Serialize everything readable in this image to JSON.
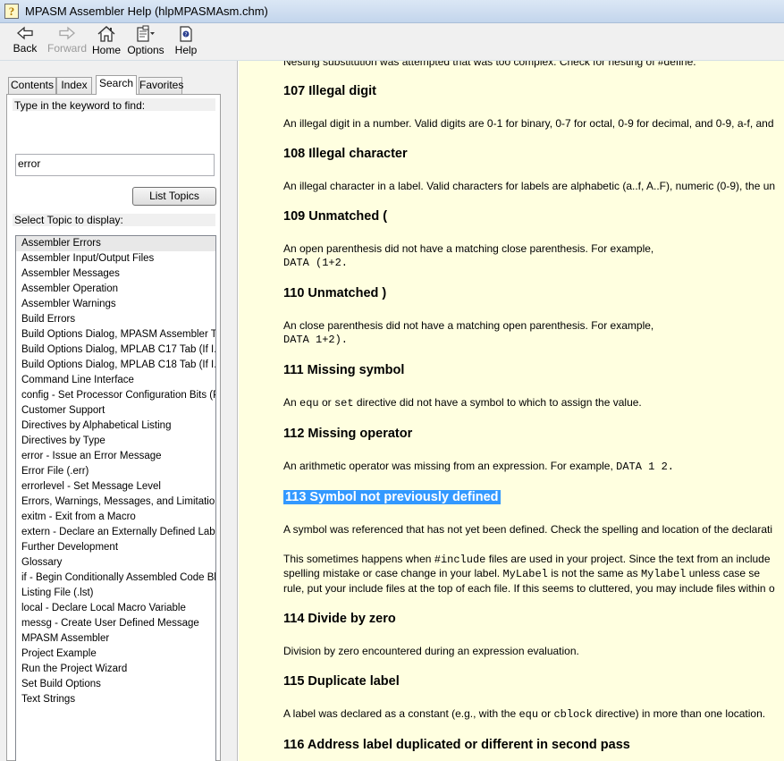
{
  "window": {
    "title": "MPASM Assembler Help (hlpMPASMAsm.chm)"
  },
  "toolbar": {
    "back": "Back",
    "forward": "Forward",
    "home": "Home",
    "options": "Options",
    "help": "Help"
  },
  "tabs": [
    "Contents",
    "Index",
    "Search",
    "Favorites"
  ],
  "search": {
    "prompt": "Type in the keyword to find:",
    "value": "error",
    "list_button": "List Topics",
    "select_label": "Select Topic to display:"
  },
  "topics": [
    "Assembler Errors",
    "Assembler Input/Output Files",
    "Assembler Messages",
    "Assembler Operation",
    "Assembler Warnings",
    "Build Errors",
    "Build Options Dialog, MPASM Assembler T...",
    "Build Options Dialog, MPLAB C17 Tab (If I...",
    "Build Options Dialog, MPLAB C18 Tab (If I...",
    "Command Line Interface",
    "config - Set Processor Configuration Bits (P...",
    "Customer Support",
    "Directives by Alphabetical Listing",
    "Directives by Type",
    "error - Issue an Error Message",
    "Error File (.err)",
    "errorlevel - Set Message Level",
    "Errors, Warnings, Messages, and Limitations",
    "exitm - Exit from a Macro",
    "extern - Declare an Externally Defined Label",
    "Further Development",
    "Glossary",
    "if - Begin Conditionally Assembled Code Blo...",
    "Listing File (.lst)",
    "local - Declare Local Macro Variable",
    "messg - Create User Defined Message",
    "MPASM Assembler",
    "Project Example",
    "Run the Project Wizard",
    "Set Build Options",
    "Text Strings"
  ],
  "content": {
    "top_partial": "Nesting substitution was attempted that was too complex. Check for nesting of #define.",
    "e107_title": "107 Illegal digit",
    "e107_text": "An illegal digit in a number. Valid digits are 0-1 for binary, 0-7 for octal, 0-9 for decimal, and 0-9, a-f, and",
    "e108_title": "108 Illegal character",
    "e108_text": "An illegal character in a label. Valid characters for labels are alphabetic (a..f, A..F), numeric (0-9), the un",
    "e109_title": "109 Unmatched (",
    "e109_text": "An open parenthesis did not have a matching close parenthesis. For example,",
    "e109_code": "DATA (1+2.",
    "e110_title": "110 Unmatched )",
    "e110_text": "An close parenthesis did not have a matching open parenthesis. For example,",
    "e110_code": "DATA 1+2).",
    "e111_title": "111 Missing symbol",
    "e111_text_a": "An ",
    "e111_code_a": "equ",
    "e111_text_b": " or ",
    "e111_code_b": "set",
    "e111_text_c": " directive did not have a symbol to which to assign the value.",
    "e112_title": "112 Missing operator",
    "e112_text": "An arithmetic operator was missing from an expression. For example, ",
    "e112_code": "DATA 1 2.",
    "e113_title": "113 Symbol not previously defined",
    "e113_text": "A symbol was referenced that has not yet been defined. Check the spelling and location of the declarati",
    "e113_p2_a": "This sometimes happens when ",
    "e113_p2_code": "#include",
    "e113_p2_b": " files are used in your project. Since the text from an include",
    "e113_p2_line2_a": "spelling mistake or case change in your label. ",
    "e113_p2_code2": "MyLabel",
    "e113_p2_line2_b": " is not the same as ",
    "e113_p2_code3": "Mylabel",
    "e113_p2_line2_c": " unless case se",
    "e113_p2_line3": "rule, put your include files at the top of each file. If this seems to cluttered, you may include files within o",
    "e114_title": "114 Divide by zero",
    "e114_text": "Division by zero encountered during an expression evaluation.",
    "e115_title": "115 Duplicate label",
    "e115_text_a": "A label was declared as a constant (e.g., with the ",
    "e115_code_a": "equ",
    "e115_text_b": " or ",
    "e115_code_b": "cblock",
    "e115_text_c": " directive) in more than one location.",
    "e116_title": "116 Address label duplicated or different in second pass"
  }
}
